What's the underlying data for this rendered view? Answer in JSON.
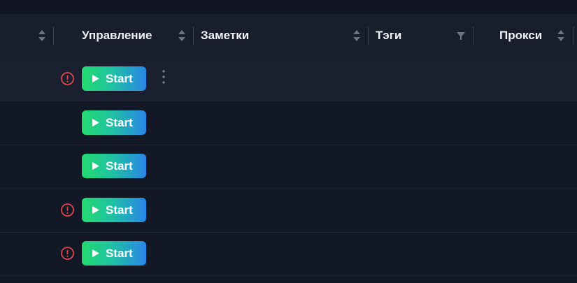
{
  "table": {
    "columns": [
      {
        "key": "control",
        "label": "Управление",
        "sort": "sort-arrows"
      },
      {
        "key": "notes",
        "label": "Заметки",
        "sort": "sort-arrows"
      },
      {
        "key": "tags",
        "label": "Тэги",
        "sort": "filter"
      },
      {
        "key": "proxy",
        "label": "Прокси",
        "sort": "sort-arrows"
      }
    ],
    "rows": [
      {
        "alert": true,
        "action_label": "Start",
        "menu": true
      },
      {
        "alert": false,
        "action_label": "Start",
        "menu": false
      },
      {
        "alert": false,
        "action_label": "Start",
        "menu": false
      },
      {
        "alert": true,
        "action_label": "Start",
        "menu": false
      },
      {
        "alert": true,
        "action_label": "Start",
        "menu": false
      }
    ]
  },
  "icons": {
    "sort": "sort-arrows-icon",
    "filter": "filter-icon",
    "alert": "alert-circle-icon",
    "play": "play-icon",
    "menu": "kebab-menu-icon"
  },
  "colors": {
    "background": "#121826",
    "header": "#181e2c",
    "alert": "#e0474c",
    "button_gradient": [
      "#24d96f",
      "#2a86e8"
    ]
  }
}
